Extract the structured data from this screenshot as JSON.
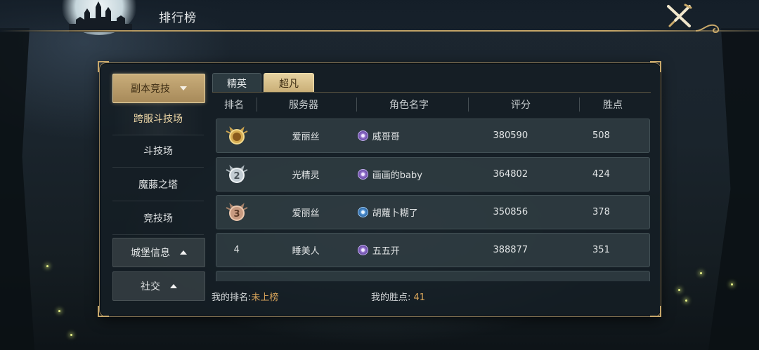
{
  "page": {
    "title": "排行榜"
  },
  "sidebar": {
    "category": {
      "label": "副本竞技"
    },
    "subitems": [
      "跨服斗技场",
      "斗技场",
      "魔藤之塔",
      "竞技场"
    ],
    "sections": [
      {
        "label": "城堡信息"
      },
      {
        "label": "社交"
      }
    ]
  },
  "tabs": [
    {
      "label": "精英"
    },
    {
      "label": "超凡"
    }
  ],
  "table": {
    "headers": [
      "排名",
      "服务器",
      "角色名字",
      "评分",
      "胜点"
    ],
    "rows": [
      {
        "rank": "1",
        "server": "爱丽丝",
        "name": "威哥哥",
        "class_icon": "purple-orb-icon",
        "score": "380590",
        "wins": "508"
      },
      {
        "rank": "2",
        "server": "光精灵",
        "name": "画画的baby",
        "class_icon": "purple-orb-icon",
        "score": "364802",
        "wins": "424"
      },
      {
        "rank": "3",
        "server": "爱丽丝",
        "name": "胡蘿卜糊了",
        "class_icon": "blue-flame-icon",
        "score": "350856",
        "wins": "378"
      },
      {
        "rank": "4",
        "server": "睡美人",
        "name": "五五开",
        "class_icon": "purple-orb-icon",
        "score": "388877",
        "wins": "351"
      }
    ]
  },
  "footer": {
    "my_rank_label": "我的排名:",
    "my_rank_value": "未上榜",
    "my_wins_label": "我的胜点:",
    "my_wins_value": "41"
  },
  "colors": {
    "gold": "#c9ad7a",
    "accent_value": "#d8a45a",
    "panel_border": "#8c7a58"
  }
}
